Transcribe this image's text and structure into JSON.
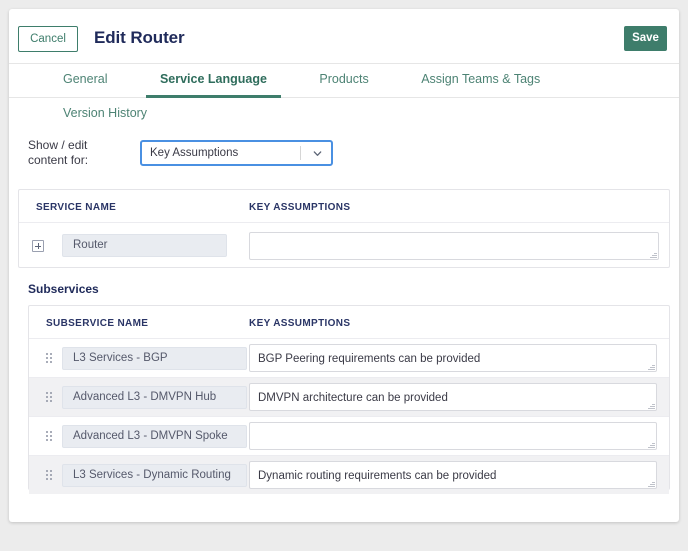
{
  "header": {
    "cancel_label": "Cancel",
    "title": "Edit Router",
    "save_label": "Save"
  },
  "tabs": [
    {
      "label": "General",
      "active": false
    },
    {
      "label": "Service Language",
      "active": true
    },
    {
      "label": "Products",
      "active": false
    },
    {
      "label": "Assign Teams & Tags",
      "active": false
    },
    {
      "label": "Version History",
      "active": false
    }
  ],
  "selector": {
    "label": "Show / edit content for:",
    "value": "Key Assumptions"
  },
  "service_table": {
    "columns": [
      "SERVICE NAME",
      "KEY ASSUMPTIONS"
    ],
    "rows": [
      {
        "name": "Router",
        "key_assumptions": ""
      }
    ]
  },
  "subservices": {
    "title": "Subservices",
    "columns": [
      "SUBSERVICE NAME",
      "KEY ASSUMPTIONS"
    ],
    "rows": [
      {
        "name": "L3 Services - BGP",
        "key_assumptions": "BGP Peering requirements can be provided"
      },
      {
        "name": "Advanced L3 - DMVPN Hub",
        "key_assumptions": "DMVPN architecture can be provided"
      },
      {
        "name": "Advanced L3 - DMVPN Spoke",
        "key_assumptions": ""
      },
      {
        "name": "L3 Services - Dynamic Routing",
        "key_assumptions": "Dynamic routing requirements can be provided"
      }
    ]
  },
  "colors": {
    "accent_green": "#3e7d6b",
    "title_navy": "#1f2a5a",
    "focus_blue": "#4a90e2",
    "row_alt": "#f1f1f3",
    "page_bg": "#ececec"
  }
}
